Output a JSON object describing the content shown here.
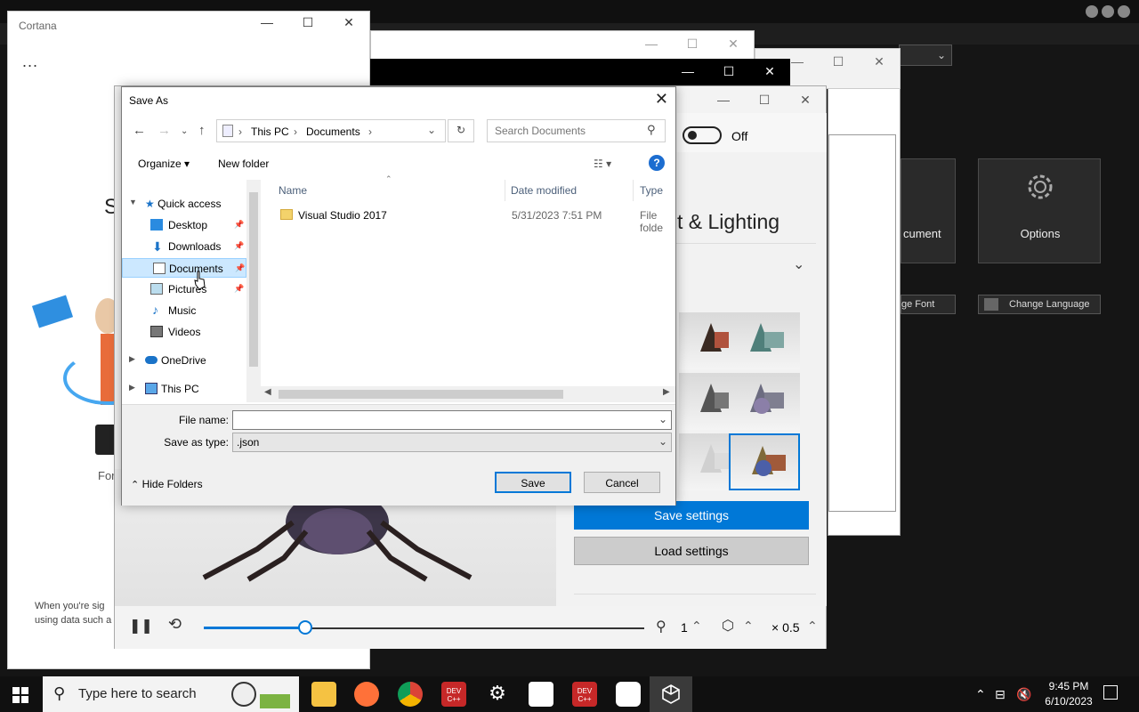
{
  "devcpp": {
    "tile_document_label": "cument",
    "tile_options_label": "Options",
    "font_button": "ge Font",
    "language_button": "Change Language"
  },
  "cortana": {
    "title": "Cortana",
    "dots": "...",
    "heading_fragment": "S",
    "for_fragment": "For",
    "footer_line1": "When you're sig",
    "footer_line2": "using data such a"
  },
  "viewer": {
    "toggle_label": "Off",
    "section_title": "t & Lighting",
    "save_settings": "Save settings",
    "load_settings": "Load settings",
    "speed_value": "1",
    "scale_value": "× 0.5",
    "timeline_progress": 0.23
  },
  "save_as": {
    "title": "Save As",
    "breadcrumb": [
      "This PC",
      "Documents"
    ],
    "search_placeholder": "Search Documents",
    "organize": "Organize",
    "new_folder": "New folder",
    "nav": {
      "quick_access": "Quick access",
      "desktop": "Desktop",
      "downloads": "Downloads",
      "documents": "Documents",
      "pictures": "Pictures",
      "music": "Music",
      "videos": "Videos",
      "onedrive": "OneDrive",
      "this_pc": "This PC"
    },
    "columns": {
      "name": "Name",
      "date_modified": "Date modified",
      "type": "Type"
    },
    "files": [
      {
        "name": "Visual Studio 2017",
        "date": "5/31/2023 7:51 PM",
        "type": "File folde"
      }
    ],
    "file_name_label": "File name:",
    "file_name_value": "",
    "save_type_label": "Save as type:",
    "save_type_value": ".json",
    "hide_folders": "Hide Folders",
    "save_button": "Save",
    "cancel_button": "Cancel"
  },
  "taskbar": {
    "search_placeholder": "Type here to search",
    "time": "9:45 PM",
    "date": "6/10/2023",
    "dev_label": "DEV C++"
  },
  "colors": {
    "accent": "#0078d7",
    "selected_nav": "#cce8ff",
    "folder": "#f3d26b"
  }
}
